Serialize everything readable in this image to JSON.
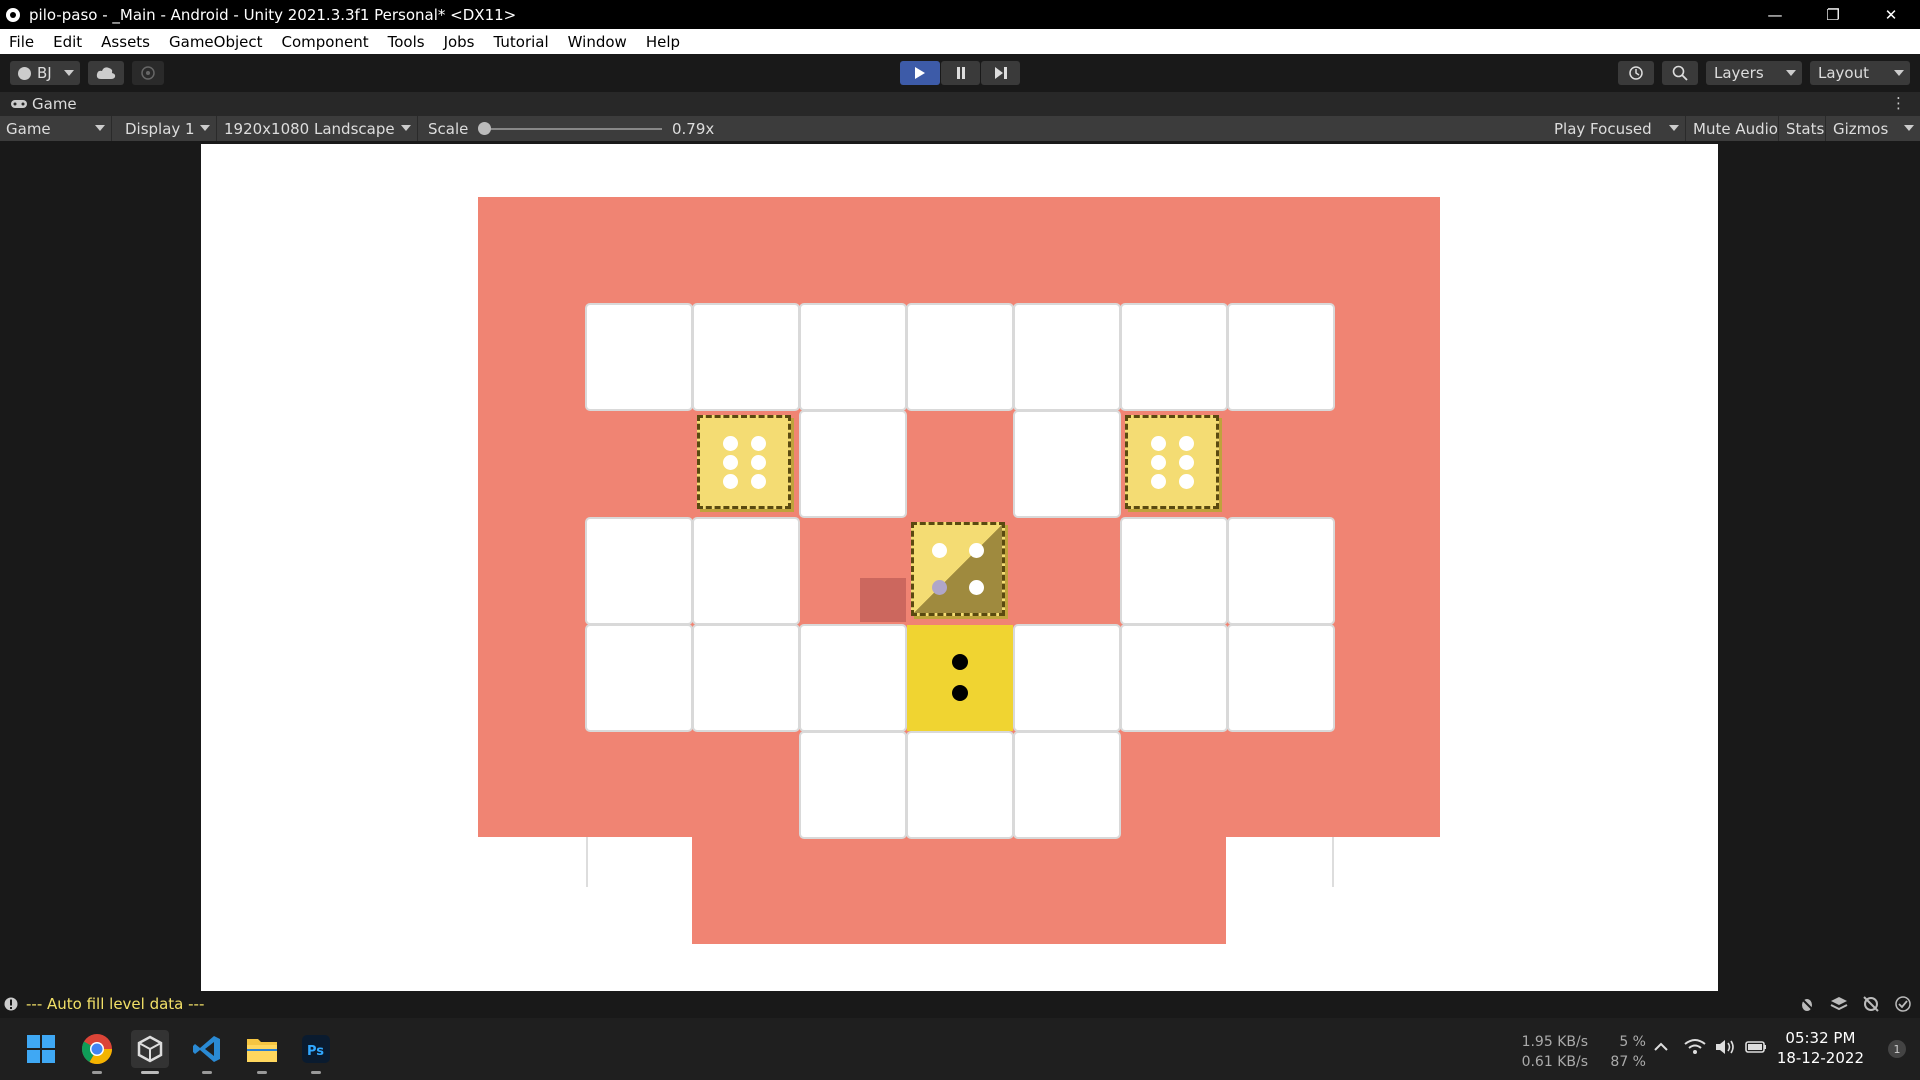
{
  "window": {
    "title": "pilo-paso - _Main - Android - Unity 2021.3.3f1 Personal* <DX11>",
    "controls": [
      "—",
      "❐",
      "✕"
    ]
  },
  "menu": [
    "File",
    "Edit",
    "Assets",
    "GameObject",
    "Component",
    "Tools",
    "Jobs",
    "Tutorial",
    "Window",
    "Help"
  ],
  "toolbar": {
    "account": "BJ",
    "layers": "Layers",
    "layout": "Layout"
  },
  "game_tab": {
    "label": "Game"
  },
  "game_bar": {
    "view": "Game",
    "display": "Display 1",
    "resolution": "1920x1080 Landscape",
    "scale_label": "Scale",
    "scale_value": "0.79x",
    "play_focused": "Play Focused",
    "mute_audio": "Mute Audio",
    "stats": "Stats",
    "gizmos": "Gizmos"
  },
  "status": {
    "message": "--- Auto fill level data ---"
  },
  "taskbar": {
    "net_up": "1.95 KB/s",
    "net_down": "0.61 KB/s",
    "cpu": "5 %",
    "mem": "87 %",
    "time": "05:32 PM",
    "date": "18-12-2022",
    "notifications": "1"
  },
  "colors": {
    "board_red": "#f08473",
    "dice_yellow": "#f0d431",
    "ghost_yellow": "#f4dc73",
    "status_yellow": "#f2e067",
    "play_blue": "#3d5ba8"
  }
}
